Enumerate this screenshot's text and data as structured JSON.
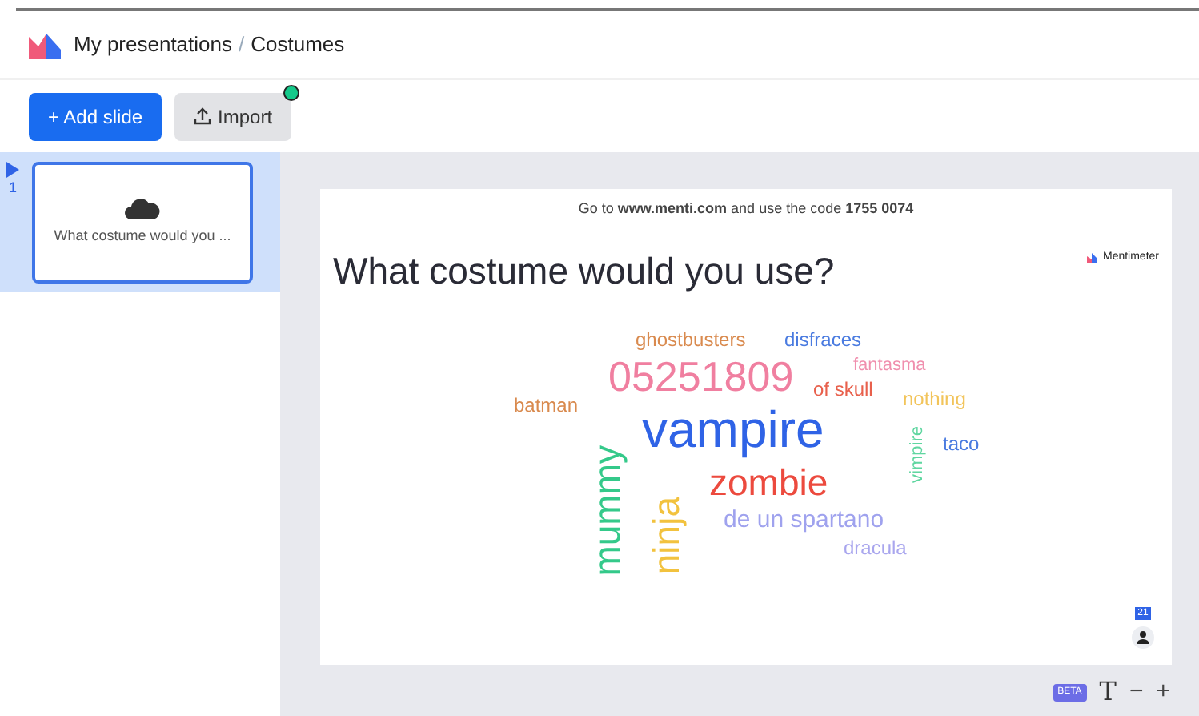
{
  "breadcrumb": {
    "parent": "My presentations",
    "separator": "/",
    "current": "Costumes"
  },
  "toolbar": {
    "add_button": "+ Add slide",
    "import_button": "Import",
    "import_badge": true
  },
  "slides": [
    {
      "number": "1",
      "title": "What costume would you ...",
      "selected": true
    }
  ],
  "slide": {
    "instructions": "Go to **www.menti.com** and use the code **1755 0074**",
    "question": "What costume would you use?",
    "brand": "Mentimeter",
    "participants": "21",
    "words": [
      {
        "text": "ghostbusters",
        "color": "#d98a4e",
        "kind": "horizontal"
      },
      {
        "text": "disfraces",
        "color": "#4a7be0",
        "kind": "horizontal"
      },
      {
        "text": "fantasma",
        "color": "#f08fae",
        "kind": "horizontal"
      },
      {
        "text": "05251809",
        "color": "#f07fa0",
        "kind": "horizontal"
      },
      {
        "text": "batman",
        "color": "#d98a4e",
        "kind": "horizontal"
      },
      {
        "text": "of skull",
        "color": "#e8604c",
        "kind": "horizontal"
      },
      {
        "text": "nothing",
        "color": "#f2c45a",
        "kind": "horizontal"
      },
      {
        "text": "vampire",
        "color": "#2f63e6",
        "kind": "horizontal"
      },
      {
        "text": "vimpire",
        "color": "#5fd6a0",
        "kind": "vertical"
      },
      {
        "text": "taco",
        "color": "#4a7be0",
        "kind": "horizontal"
      },
      {
        "text": "mummy",
        "color": "#34c98a",
        "kind": "vertical"
      },
      {
        "text": "zombie",
        "color": "#ec4a3e",
        "kind": "horizontal"
      },
      {
        "text": "ninja",
        "color": "#f2c23e",
        "kind": "vertical"
      },
      {
        "text": "de un spartano",
        "color": "#9fa2ee",
        "kind": "horizontal"
      },
      {
        "text": "dracula",
        "color": "#a9a6ee",
        "kind": "horizontal"
      }
    ]
  },
  "footer": {
    "beta": "BETA",
    "text_tool": "T",
    "minus": "−",
    "plus": "+"
  }
}
